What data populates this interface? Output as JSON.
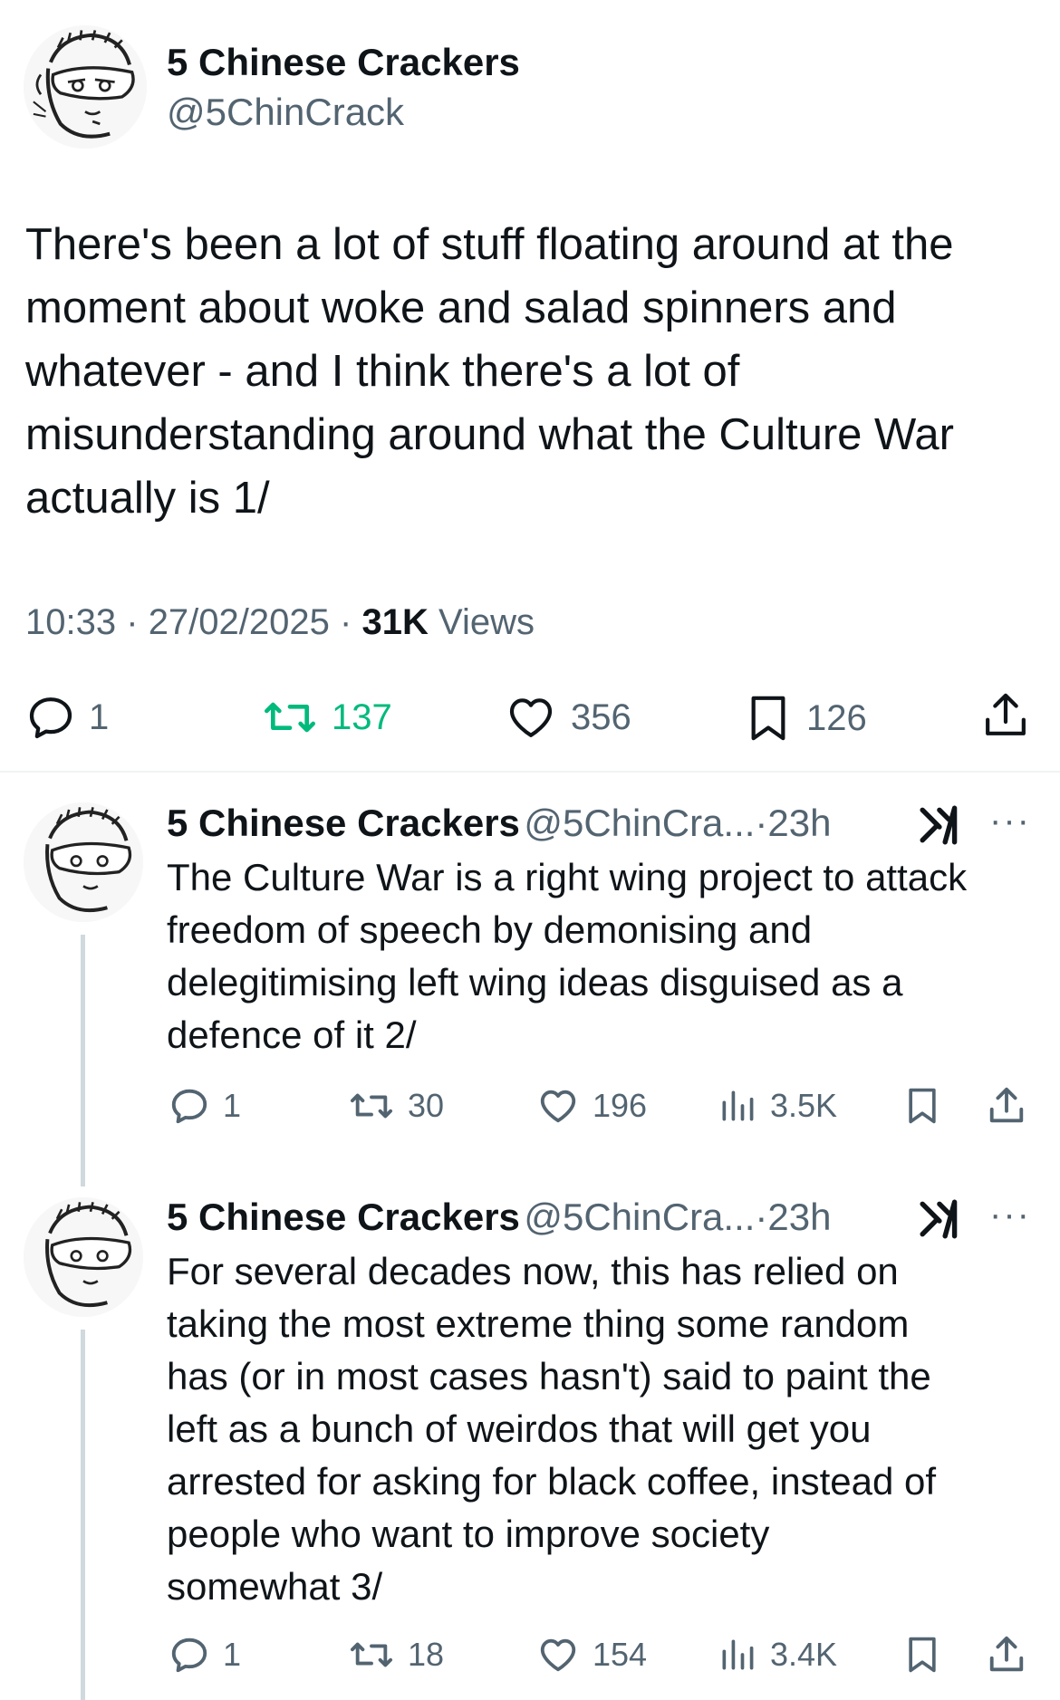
{
  "main_tweet": {
    "display_name": "5 Chinese Crackers",
    "handle": "@5ChinCrack",
    "text_lines": [
      "There's been a lot of stuff floating around at the",
      "moment about woke and salad spinners and",
      "whatever - and I think there's a lot of",
      "misunderstanding around what the Culture War",
      "actually is 1/"
    ],
    "time": "10:33",
    "date": "27/02/2025",
    "views_count": "31K",
    "views_label": "Views",
    "replies": "1",
    "retweets": "137",
    "likes": "356",
    "bookmarks": "126"
  },
  "replies": [
    {
      "display_name": "5 Chinese Crackers",
      "handle": "@5ChinCra...",
      "age": "23h",
      "text_lines": [
        "The Culture War is a right wing project to attack",
        "freedom of speech by demonising and",
        "delegitimising left wing ideas disguised as a",
        "defence of it 2/"
      ],
      "replies": "1",
      "retweets": "30",
      "likes": "196",
      "views": "3.5K"
    },
    {
      "display_name": "5 Chinese Crackers",
      "handle": "@5ChinCra...",
      "age": "23h",
      "text_lines": [
        "For several decades now, this has relied on",
        "taking the most extreme thing some random",
        "has (or in most cases hasn't) said to paint the",
        "left as a bunch of weirdos that will get you",
        "arrested for asking for black coffee, instead of",
        "people who want to improve society",
        "somewhat 3/"
      ],
      "replies": "1",
      "retweets": "18",
      "likes": "154",
      "views": "3.4K"
    }
  ],
  "icons": {
    "reply": "reply-icon",
    "retweet": "retweet-icon",
    "like": "heart-icon",
    "bookmark": "bookmark-icon",
    "share": "share-icon",
    "views": "views-icon",
    "grok": "grok-icon",
    "more": "more-icon"
  },
  "colors": {
    "text": "#0f1419",
    "secondary": "#536471",
    "retweet_active": "#00ba7c",
    "thread_line": "#cfd9de"
  },
  "separator": "·",
  "more_glyph": "···"
}
